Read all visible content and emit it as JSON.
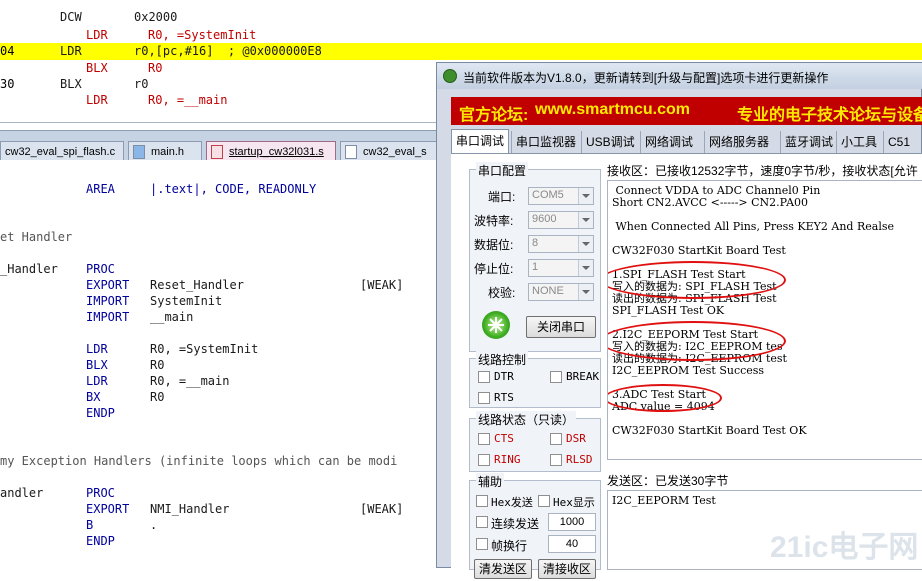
{
  "disassembly": [
    {
      "addr": "",
      "op": "DCW",
      "args": "0x2000",
      "highlight": false,
      "indent": false
    },
    {
      "addr": "",
      "op": "LDR",
      "args": "R0, =SystemInit",
      "highlight": false,
      "indent": true
    },
    {
      "addr": "04",
      "op": "LDR",
      "args": "r0,[pc,#16]  ; @0x000000E8",
      "highlight": true,
      "indent": false
    },
    {
      "addr": "",
      "op": "BLX",
      "args": "R0",
      "highlight": false,
      "indent": true
    },
    {
      "addr": "30",
      "op": "BLX",
      "args": "r0",
      "highlight": false,
      "indent": false
    },
    {
      "addr": "",
      "op": "LDR",
      "args": "R0, =__main",
      "highlight": false,
      "indent": true
    }
  ],
  "file_tabs": [
    {
      "label": "cw32_eval_spi_flash.c",
      "active": false
    },
    {
      "label": "main.h",
      "active": false
    },
    {
      "label": "startup_cw32l031.s",
      "active": true
    },
    {
      "label": "cw32_eval_s",
      "active": false
    }
  ],
  "editor_lines": [
    {
      "label": "",
      "op": "AREA",
      "args": "|.text|, CODE, READONLY",
      "attr": ""
    },
    {
      "label": "et Handler",
      "op": "",
      "args": "",
      "attr": "",
      "comment": true
    },
    {
      "label": "_Handler",
      "op": "PROC",
      "args": "",
      "attr": ""
    },
    {
      "label": "",
      "op": "EXPORT",
      "args": "Reset_Handler",
      "attr": "[WEAK]"
    },
    {
      "label": "",
      "op": "IMPORT",
      "args": "SystemInit",
      "attr": ""
    },
    {
      "label": "",
      "op": "IMPORT",
      "args": "__main",
      "attr": ""
    },
    {
      "label": "",
      "op": "LDR",
      "args": "R0, =SystemInit",
      "attr": ""
    },
    {
      "label": "",
      "op": "BLX",
      "args": "R0",
      "attr": ""
    },
    {
      "label": "",
      "op": "LDR",
      "args": "R0, =__main",
      "attr": ""
    },
    {
      "label": "",
      "op": "BX",
      "args": "R0",
      "attr": ""
    },
    {
      "label": "",
      "op": "ENDP",
      "args": "",
      "attr": ""
    },
    {
      "label": "my Exception Handlers (infinite loops which can be modi",
      "op": "",
      "args": "",
      "attr": "",
      "comment": true
    },
    {
      "label": "andler",
      "op": "PROC",
      "args": "",
      "attr": ""
    },
    {
      "label": "",
      "op": "EXPORT",
      "args": "NMI_Handler",
      "attr": "[WEAK]"
    },
    {
      "label": "",
      "op": "B",
      "args": ".",
      "attr": ""
    },
    {
      "label": "",
      "op": "ENDP",
      "args": "",
      "attr": ""
    }
  ],
  "tool": {
    "title": "当前软件版本为V1.8.0，更新请转到[升级与配置]选项卡进行更新操作",
    "banner": {
      "part1": "官方论坛:",
      "part2": "www.smartmcu.com",
      "part3": "专业的电子技术论坛与设备"
    },
    "tabs": [
      "串口调试",
      "串口监视器",
      "USB调试",
      "网络调试",
      "网络服务器",
      "蓝牙调试",
      "小工具",
      "C51代码"
    ],
    "serial_config": {
      "title": "串口配置",
      "fields": [
        {
          "label": "端口:",
          "value": "COM5"
        },
        {
          "label": "波特率:",
          "value": "9600"
        },
        {
          "label": "数据位:",
          "value": "8"
        },
        {
          "label": "停止位:",
          "value": "1"
        },
        {
          "label": "校验:",
          "value": "NONE"
        }
      ],
      "close_button": "关闭串口"
    },
    "line_control": {
      "title": "线路控制",
      "dtr": "DTR",
      "brk": "BREAK",
      "rts": "RTS"
    },
    "line_status": {
      "title": "线路状态（只读）",
      "cts": "CTS",
      "dsr": "DSR",
      "ring": "RING",
      "rlsd": "RLSD"
    },
    "aux": {
      "title": "辅助",
      "hex_send": "Hex发送",
      "hex_show": "Hex显示",
      "continuous": "连续发送",
      "interval": "1000",
      "frame_newline": "帧换行",
      "frame_value": "40",
      "btn1": "清发送区",
      "btn2": "清接收区"
    },
    "receive": {
      "header": "接收区：已接收12532字节，速度0字节/秒，接收状态[允许",
      "lines": [
        " Connect VDDA to ADC Channel0 Pin",
        "Short CN2.AVCC <-----> CN2.PA00",
        "",
        " When Connected All Pins, Press KEY2 And Realse",
        "",
        "CW32F030 StartKit Board Test",
        "",
        "1.SPI_FLASH Test Start",
        "写入的数据为: SPI_FLASH Test",
        "读出的数据为: SPI_FLASH Test",
        "SPI_FLASH Test OK",
        "",
        "2.I2C_EEPORM Test Start",
        "写入的数据为: I2C_EEPROM tes",
        "读出的数据为: I2C_EEPROM test",
        "I2C_EEPROM Test Success",
        "",
        "3.ADC Test Start",
        "ADC value = 4094",
        "",
        "CW32F030 StartKit Board Test OK"
      ]
    },
    "send": {
      "header": "发送区：已发送30字节",
      "content": "I2C_EEPORM Test"
    },
    "watermark": "21ic电子网"
  },
  "colors": {
    "highlight": "#ffff00",
    "banner_bg": "#c00000",
    "banner_text": "#ffeb00",
    "annotation": "#e01010"
  }
}
